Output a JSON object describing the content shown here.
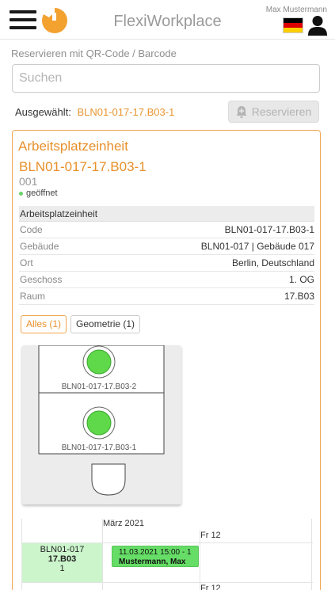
{
  "header": {
    "title": "FlexiWorkplace",
    "username": "Max Mustermann",
    "menu_icon": "hamburger-menu-icon",
    "logo_icon": "app-logo-icon",
    "language_flag": "german-flag-icon",
    "user_icon": "user-icon"
  },
  "page": {
    "title": "Reservieren mit QR-Code / Barcode"
  },
  "search": {
    "placeholder": "Suchen",
    "value": ""
  },
  "selection": {
    "label": "Ausgewählt:",
    "selected_id": "BLN01-017-17.B03-1",
    "reserve_label": "Reservieren",
    "reserve_icon": "bell-plus-icon"
  },
  "card": {
    "type": "Arbeitsplatzeinheit",
    "name": "BLN01-017-17.B03-1",
    "number": "001",
    "status": "geöffnet",
    "properties_header": "Arbeitsplatzeinheit",
    "properties": [
      {
        "key": "Code",
        "value": "BLN01-017-17.B03-1"
      },
      {
        "key": "Gebäude",
        "value": "BLN01-017 | Gebäude 017"
      },
      {
        "key": "Ort",
        "value": "Berlin, Deutschland"
      },
      {
        "key": "Geschoss",
        "value": "1. OG"
      },
      {
        "key": "Raum",
        "value": "17.B03"
      }
    ],
    "tabs": [
      {
        "label": "Alles (1)",
        "active": true
      },
      {
        "label": "Geometrie (1)",
        "active": false
      }
    ]
  },
  "floorplan": {
    "desks": [
      {
        "label": "BLN01-017-17.B03-2",
        "status": "free"
      },
      {
        "label": "BLN01-017-17.B03-1",
        "status": "free"
      }
    ]
  },
  "calendar": {
    "month": "März 2021",
    "day": "Fr 12",
    "day_repeat": "Fr 12",
    "resource": {
      "line1": "BLN01-017",
      "line2": "17.B03",
      "line3": "1"
    },
    "event": {
      "time": "11.03.2021 15:00 - 1",
      "person": "Mustermann, Max"
    }
  },
  "colors": {
    "accent": "#e8902a",
    "free": "#5fd94a",
    "event": "#66dd66"
  }
}
